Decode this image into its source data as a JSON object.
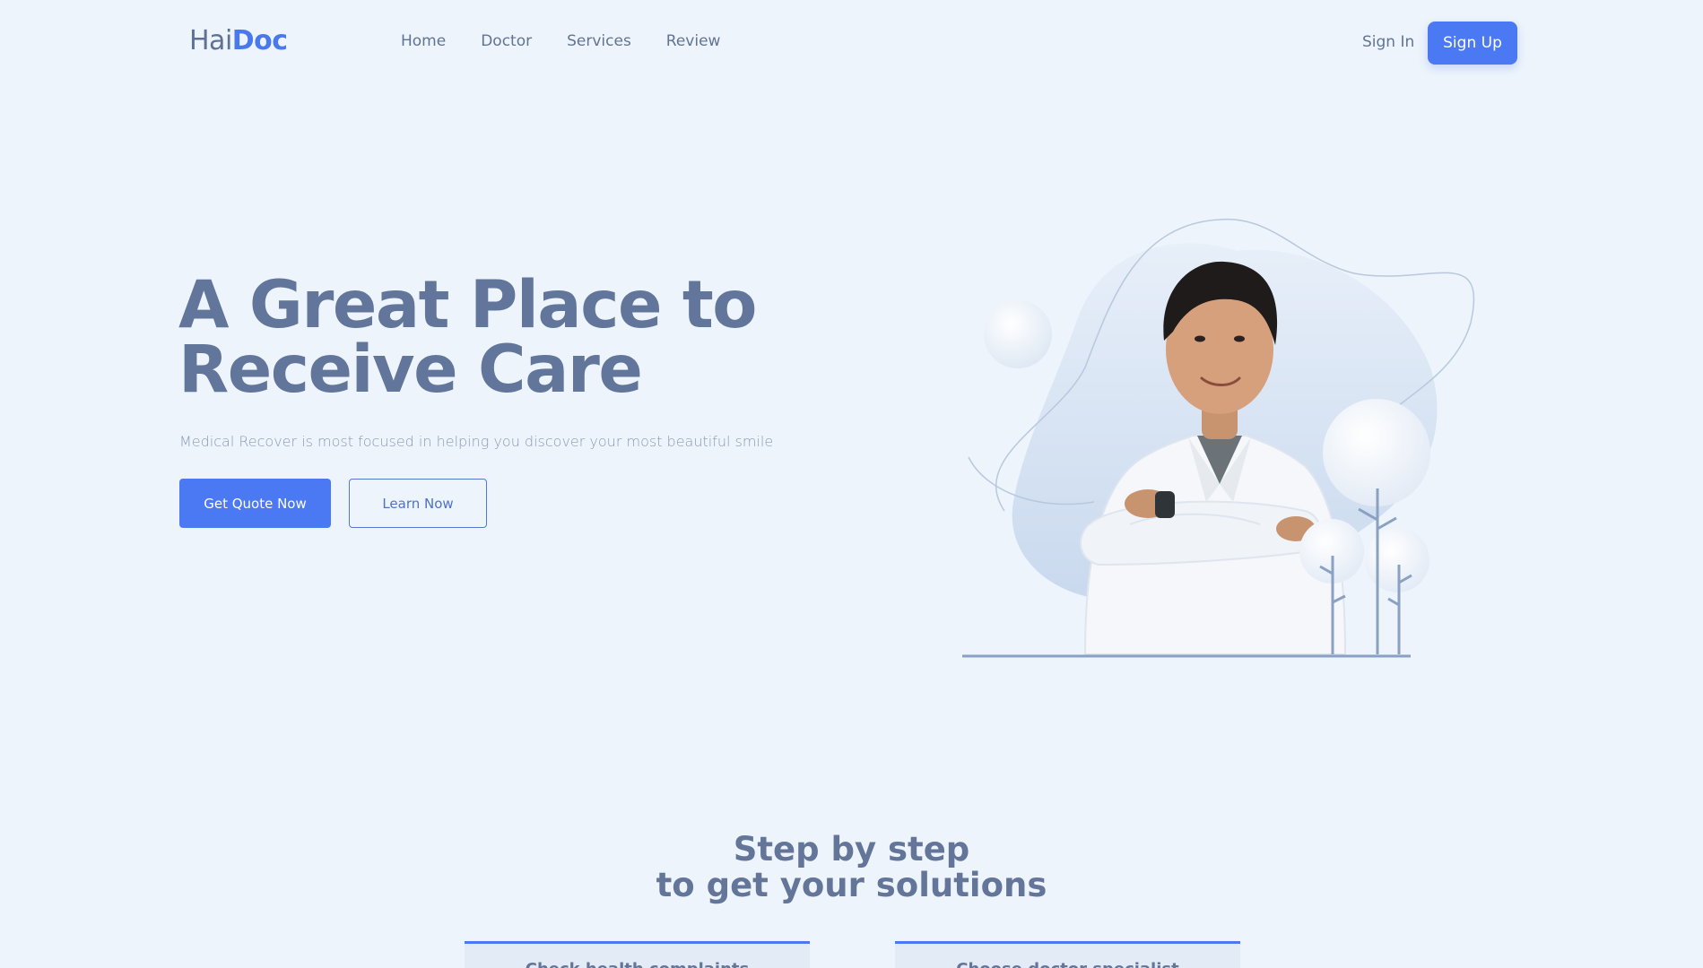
{
  "brand": {
    "light": "Hai",
    "bold": "Doc"
  },
  "nav": {
    "items": [
      {
        "label": "Home"
      },
      {
        "label": "Doctor"
      },
      {
        "label": "Services"
      },
      {
        "label": "Review"
      }
    ],
    "sign_in": "Sign In",
    "sign_up": "Sign Up"
  },
  "hero": {
    "title_line1": "A Great Place to",
    "title_line2": "Receive Care",
    "subtitle": "Medical Recover is most focused in helping you discover your most beautiful smile",
    "primary_button": "Get Quote Now",
    "secondary_button": "Learn Now"
  },
  "steps": {
    "title_line1": "Step by step",
    "title_line2": "to get your solutions",
    "cards": [
      {
        "label": "Check health complaints"
      },
      {
        "label": "Choose doctor specialist"
      }
    ]
  },
  "colors": {
    "background": "#edf4fb",
    "accent": "#4b79f3",
    "heading": "#62759a",
    "text": "#627493"
  }
}
